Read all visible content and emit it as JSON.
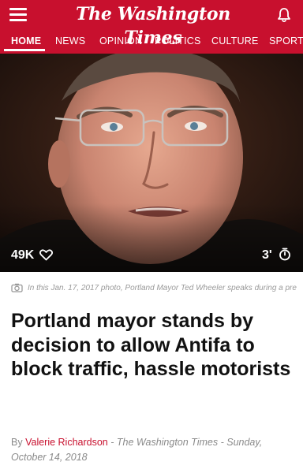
{
  "header": {
    "brand": "The Washington Times",
    "colors": {
      "brand_red": "#c8102e"
    },
    "menu_icon": "hamburger-menu-icon",
    "bell_icon": "bell-icon"
  },
  "nav": {
    "tabs": [
      {
        "label": "HOME",
        "active": true
      },
      {
        "label": "NEWS"
      },
      {
        "label": "OPINION"
      },
      {
        "label": "POLITICS"
      },
      {
        "label": "CULTURE"
      },
      {
        "label": "SPORTS"
      }
    ]
  },
  "hero": {
    "likes": "49K",
    "read_time": "3'"
  },
  "caption": {
    "text": "In this Jan. 17, 2017 photo, Portland Mayor Ted Wheeler speaks during a pre"
  },
  "article": {
    "headline": "Portland mayor stands by decision to allow Antifa to block traffic, hassle motorists",
    "by": "By",
    "author": "Valerie Richardson",
    "sep1": "-",
    "publication": "The Washington Times",
    "sep2": "-",
    "date": "Sunday, October 14, 2018"
  }
}
